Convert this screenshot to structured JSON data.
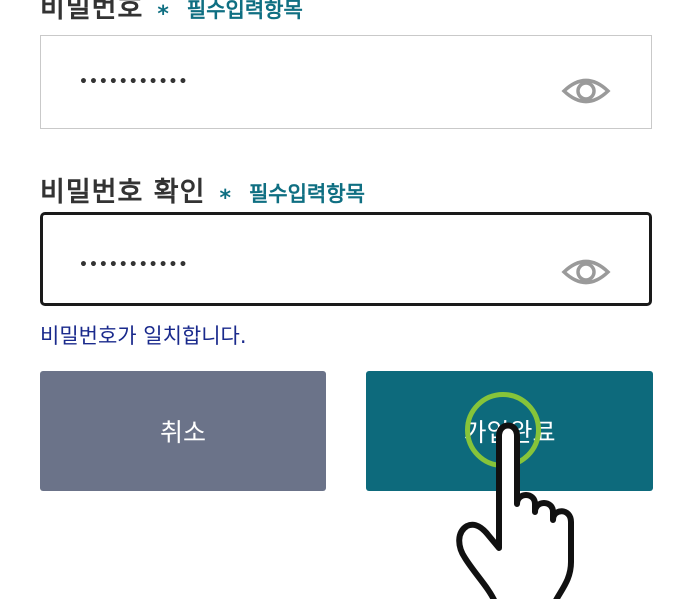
{
  "password": {
    "label": "비밀번호",
    "required_mark": "*",
    "required_text": "필수입력항목",
    "masked_value": "•••••••••••",
    "toggle_icon": "eye-icon"
  },
  "password_confirm": {
    "label": "비밀번호 확인",
    "required_mark": "*",
    "required_text": "필수입력항목",
    "masked_value": "•••••••••••",
    "toggle_icon": "eye-icon"
  },
  "match_message": "비밀번호가 일치합니다.",
  "buttons": {
    "cancel_label": "취소",
    "submit_label": "가입완료"
  },
  "colors": {
    "accent": "#0f6f82",
    "cancel_bg": "#6b7389",
    "submit_bg": "#0d6a7c",
    "match_text": "#1a2a8c",
    "touch_ring": "#86c43a"
  },
  "overlay": {
    "pointer_icon": "hand-pointer-icon",
    "touch_indicator": "touch-ring"
  }
}
